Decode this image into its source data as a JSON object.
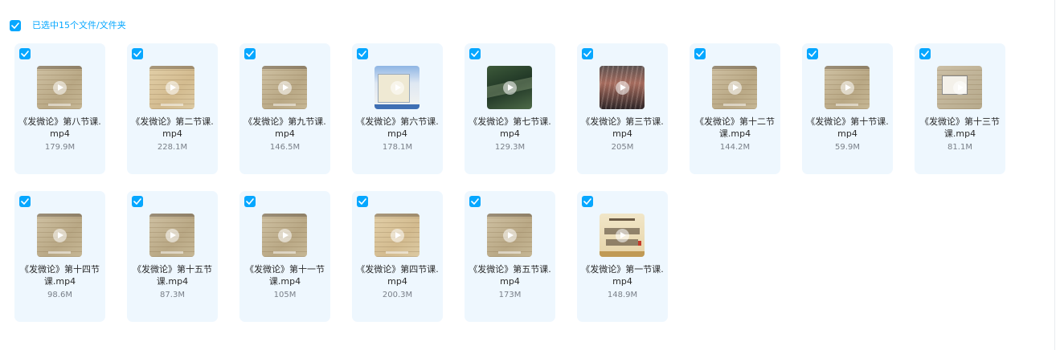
{
  "header": {
    "selection_text": "已选中15个文件/文件夹"
  },
  "files": [
    {
      "name": "《发微论》第八节课.mp4",
      "size": "179.9M",
      "thumb": "paper"
    },
    {
      "name": "《发微论》第二节课.mp4",
      "size": "228.1M",
      "thumb": "paper2"
    },
    {
      "name": "《发微论》第九节课.mp4",
      "size": "146.5M",
      "thumb": "paper"
    },
    {
      "name": "《发微论》第六节课.mp4",
      "size": "178.1M",
      "thumb": "screen"
    },
    {
      "name": "《发微论》第七节课.mp4",
      "size": "129.3M",
      "thumb": "aerial"
    },
    {
      "name": "《发微论》第三节课.mp4",
      "size": "205M",
      "thumb": "crowd"
    },
    {
      "name": "《发微论》第十二节课.mp4",
      "size": "144.2M",
      "thumb": "paper"
    },
    {
      "name": "《发微论》第十节课.mp4",
      "size": "59.9M",
      "thumb": "paper"
    },
    {
      "name": "《发微论》第十三节课.mp4",
      "size": "81.1M",
      "thumb": "doc"
    },
    {
      "name": "《发微论》第十四节课.mp4",
      "size": "98.6M",
      "thumb": "paper"
    },
    {
      "name": "《发微论》第十五节课.mp4",
      "size": "87.3M",
      "thumb": "paper"
    },
    {
      "name": "《发微论》第十一节课.mp4",
      "size": "105M",
      "thumb": "paper"
    },
    {
      "name": "《发微论》第四节课.mp4",
      "size": "200.3M",
      "thumb": "paper2"
    },
    {
      "name": "《发微论》第五节课.mp4",
      "size": "173M",
      "thumb": "paper"
    },
    {
      "name": "《发微论》第一节课.mp4",
      "size": "148.9M",
      "thumb": "cover"
    }
  ],
  "colors": {
    "accent": "#06a7ff",
    "card_bg": "#eef7fe"
  },
  "icons": {
    "checkbox": "checkmark-icon",
    "play": "play-icon"
  }
}
